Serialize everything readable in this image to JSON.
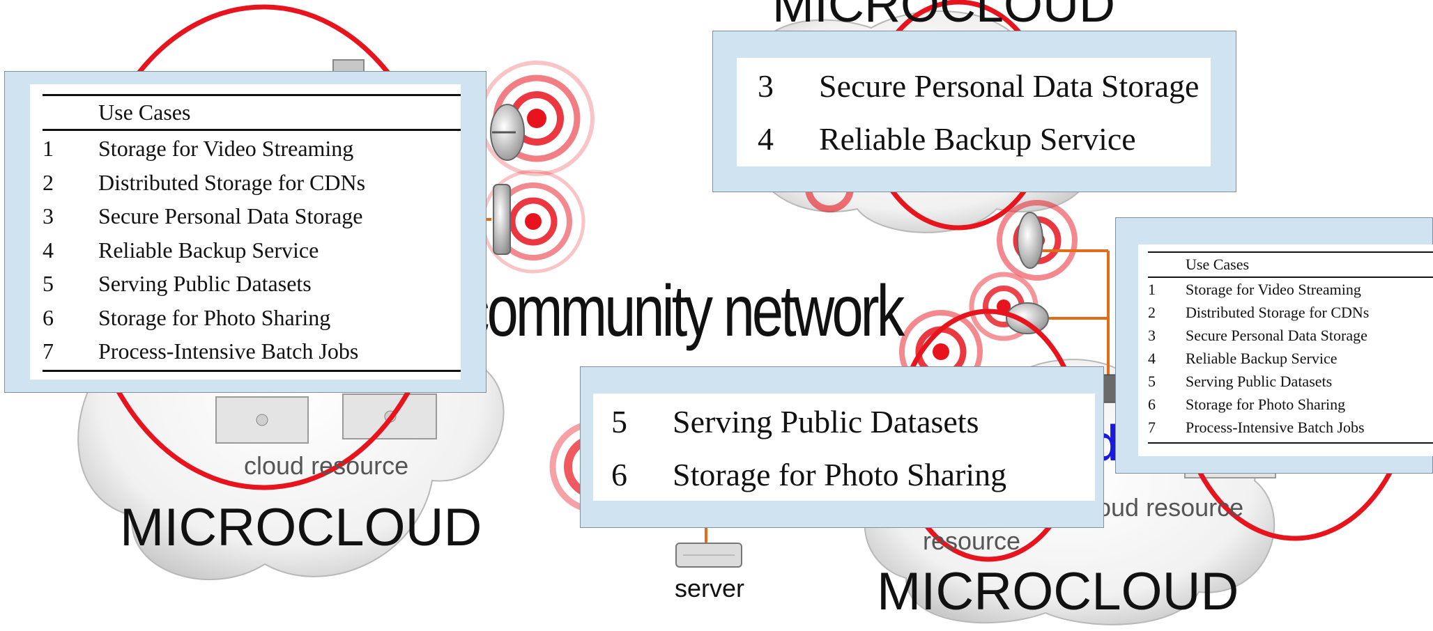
{
  "labels": {
    "microcloud_top": "MICROCLOUD",
    "microcloud_left": "MICROCLOUD",
    "microcloud_right": "MICROCLOUD",
    "community_network": "community network",
    "cloud_resource_left": "cloud resource",
    "cloud_resource_right": "cloud resource",
    "resource_mid": "resource",
    "server": "server",
    "partial_blue": "d"
  },
  "panel_large": {
    "header": "Use Cases",
    "rows": [
      {
        "num": "1",
        "text": "Storage for Video Streaming"
      },
      {
        "num": "2",
        "text": "Distributed Storage for CDNs"
      },
      {
        "num": "3",
        "text": "Secure Personal Data Storage"
      },
      {
        "num": "4",
        "text": "Reliable Backup Service"
      },
      {
        "num": "5",
        "text": "Serving Public Datasets"
      },
      {
        "num": "6",
        "text": "Storage for Photo Sharing"
      },
      {
        "num": "7",
        "text": "Process-Intensive Batch Jobs"
      }
    ]
  },
  "panel_top": {
    "rows": [
      {
        "num": "3",
        "text": "Secure Personal Data Storage"
      },
      {
        "num": "4",
        "text": "Reliable Backup Service"
      }
    ]
  },
  "panel_mid": {
    "rows": [
      {
        "num": "5",
        "text": "Serving Public Datasets"
      },
      {
        "num": "6",
        "text": "Storage for Photo Sharing"
      }
    ]
  },
  "panel_right": {
    "header": "Use Cases",
    "rows": [
      {
        "num": "1",
        "text": "Storage for Video Streaming"
      },
      {
        "num": "2",
        "text": "Distributed Storage for CDNs"
      },
      {
        "num": "3",
        "text": "Secure Personal Data Storage"
      },
      {
        "num": "4",
        "text": "Reliable Backup Service"
      },
      {
        "num": "5",
        "text": "Serving Public Datasets"
      },
      {
        "num": "6",
        "text": "Storage for Photo Sharing"
      },
      {
        "num": "7",
        "text": "Process-Intensive Batch Jobs"
      }
    ]
  },
  "colors": {
    "ellipse": "#e8141d",
    "panel_frame": "#cfe3f1",
    "link": "#e36c1a",
    "text_blue": "#1a1adf"
  }
}
